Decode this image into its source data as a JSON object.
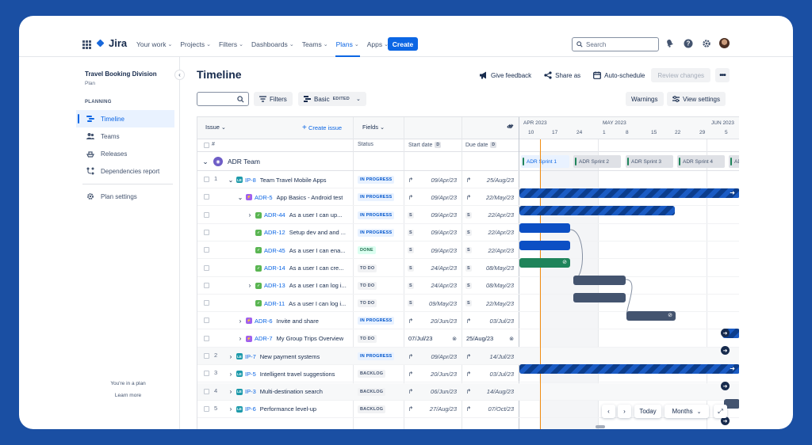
{
  "nav": {
    "logo": "Jira",
    "items": [
      {
        "label": "Your work"
      },
      {
        "label": "Projects"
      },
      {
        "label": "Filters"
      },
      {
        "label": "Dashboards"
      },
      {
        "label": "Teams"
      },
      {
        "label": "Plans"
      },
      {
        "label": "Apps"
      }
    ],
    "create": "Create",
    "search_placeholder": "Search"
  },
  "sidebar": {
    "title": "Travel Booking Division",
    "subtitle": "Plan",
    "section": "PLANNING",
    "items": [
      {
        "label": "Timeline"
      },
      {
        "label": "Teams"
      },
      {
        "label": "Releases"
      },
      {
        "label": "Dependencies report"
      }
    ],
    "settings": "Plan settings",
    "footer_text": "You're in a plan",
    "footer_link": "Learn more"
  },
  "header": {
    "title": "Timeline",
    "give_feedback": "Give feedback",
    "share": "Share as",
    "auto_schedule": "Auto-schedule",
    "review_changes": "Review changes"
  },
  "toolbar": {
    "filters": "Filters",
    "view": "Basic",
    "view_badge": "EDITED",
    "warnings": "Warnings",
    "view_settings": "View settings"
  },
  "columns": {
    "issue": "Issue",
    "create_issue": "Create issue",
    "fields": "Fields",
    "hash": "#",
    "status": "Status",
    "start_date": "Start date",
    "due_date": "Due date",
    "date_badge": "D"
  },
  "timeline": {
    "months": [
      "APR 2023",
      "MAY 2023",
      "JUN 2023"
    ],
    "days": [
      "10",
      "17",
      "24",
      "1",
      "8",
      "15",
      "22",
      "29",
      "5"
    ],
    "sprints": [
      "ADR Sprint 1",
      "ADR Sprint 2",
      "ADR Sprint 3",
      "ADR Sprint 4",
      "ADR"
    ],
    "today": "Today",
    "scale": "Months"
  },
  "team": {
    "name": "ADR Team"
  },
  "rows": [
    {
      "num": "1",
      "type": "ip",
      "key": "IP-8",
      "summary": "Team Travel Mobile Apps",
      "status": "IN PROGRESS",
      "start": "09/Apr/23",
      "due": "25/Aug/23"
    },
    {
      "num": "",
      "type": "epic",
      "key": "ADR-5",
      "summary": "App Basics - Android test",
      "status": "IN PROGRESS",
      "start": "09/Apr/23",
      "due": "22/May/23"
    },
    {
      "num": "",
      "type": "story",
      "key": "ADR-44",
      "summary": "As a user I can up...",
      "status": "IN PROGRESS",
      "start": "09/Apr/23",
      "due": "22/Apr/23",
      "sbadge": "S"
    },
    {
      "num": "",
      "type": "story",
      "key": "ADR-12",
      "summary": "Setup dev and and ...",
      "status": "IN PROGRESS",
      "start": "09/Apr/23",
      "due": "22/Apr/23",
      "sbadge": "S"
    },
    {
      "num": "",
      "type": "story",
      "key": "ADR-45",
      "summary": "As a user I can ena...",
      "status": "DONE",
      "start": "09/Apr/23",
      "due": "22/Apr/23",
      "sbadge": "S"
    },
    {
      "num": "",
      "type": "story",
      "key": "ADR-14",
      "summary": "As a user I can cre...",
      "status": "TO DO",
      "start": "24/Apr/23",
      "due": "08/May/23",
      "sbadge": "S"
    },
    {
      "num": "",
      "type": "story",
      "key": "ADR-13",
      "summary": "As a user I can log i...",
      "status": "TO DO",
      "start": "24/Apr/23",
      "due": "08/May/23",
      "sbadge": "S"
    },
    {
      "num": "",
      "type": "story",
      "key": "ADR-11",
      "summary": "As a user I can log i...",
      "status": "TO DO",
      "start": "09/May/23",
      "due": "22/May/23",
      "sbadge": "S"
    },
    {
      "num": "",
      "type": "epic",
      "key": "ADR-6",
      "summary": "Invite and share",
      "status": "IN PROGRESS",
      "start": "20/Jun/23",
      "due": "03/Jul/23"
    },
    {
      "num": "",
      "type": "epic",
      "key": "ADR-7",
      "summary": "My Group Trips Overview",
      "status": "TO DO",
      "start": "07/Jul/23",
      "due": "25/Aug/23"
    },
    {
      "num": "2",
      "type": "ip",
      "key": "IP-7",
      "summary": "New payment systems",
      "status": "IN PROGRESS",
      "start": "09/Apr/23",
      "due": "14/Jul/23"
    },
    {
      "num": "3",
      "type": "ip",
      "key": "IP-5",
      "summary": "Intelligent travel suggestions",
      "status": "BACKLOG",
      "start": "20/Jun/23",
      "due": "03/Jul/23"
    },
    {
      "num": "4",
      "type": "ip",
      "key": "IP-3",
      "summary": "Multi-destination search",
      "status": "BACKLOG",
      "start": "06/Jun/23",
      "due": "14/Aug/23"
    },
    {
      "num": "5",
      "type": "ip",
      "key": "IP-6",
      "summary": "Performance level-up",
      "status": "BACKLOG",
      "start": "27/Aug/23",
      "due": "07/Oct/23"
    }
  ],
  "icon_labels": {
    "story": "✓",
    "epic": "⚡",
    "ip": "LE"
  }
}
